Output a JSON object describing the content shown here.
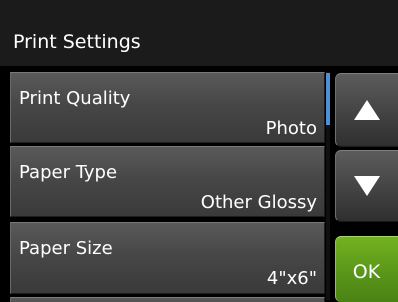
{
  "header": {
    "title": "Print Settings"
  },
  "settings": {
    "items": [
      {
        "label": "Print Quality",
        "value": "Photo"
      },
      {
        "label": "Paper Type",
        "value": "Other Glossy"
      },
      {
        "label": "Paper Size",
        "value": "4\"x6\""
      }
    ]
  },
  "buttons": {
    "up_icon": "up-arrow-icon",
    "down_icon": "down-arrow-icon",
    "ok_label": "OK"
  },
  "colors": {
    "header_bg": "#1b1b1b",
    "item_bg": "#474747",
    "scroll_thumb": "#4f8fd8",
    "ok_green": "#5a961a",
    "text": "#ffffff"
  }
}
